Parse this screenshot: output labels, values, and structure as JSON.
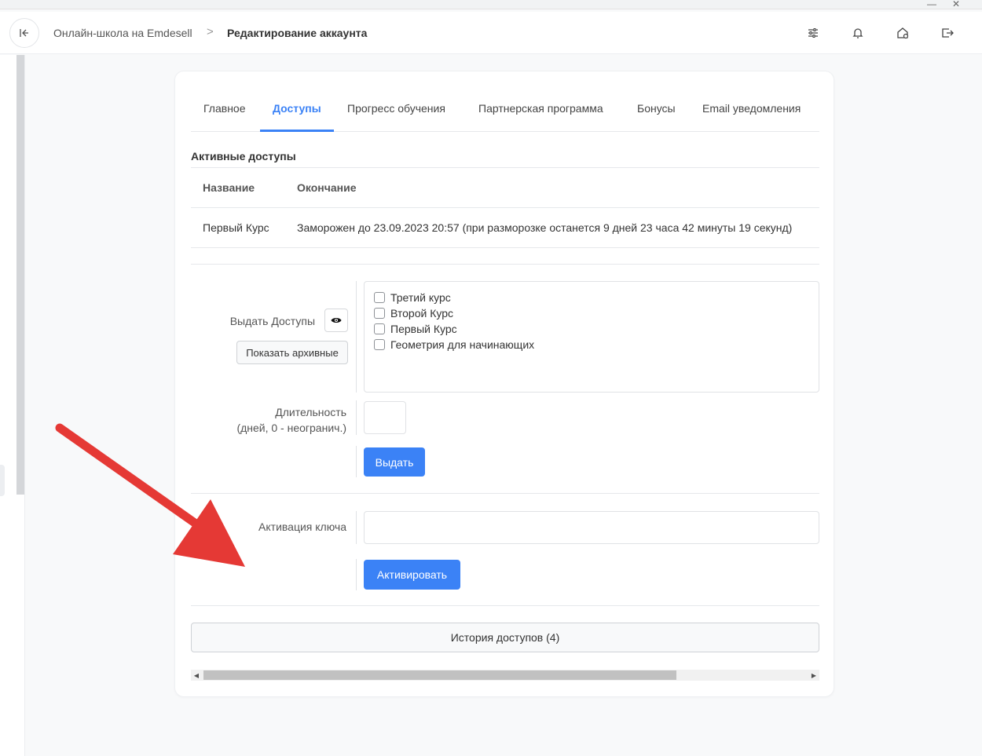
{
  "header": {
    "back_icon": "collapse-left-icon",
    "breadcrumb_root": "Онлайн-школа на Emdesell",
    "breadcrumb_separator": ">",
    "breadcrumb_current": "Редактирование аккаунта",
    "icons": [
      "sliders-icon",
      "bell-icon",
      "home-settings-icon",
      "logout-icon"
    ]
  },
  "tabs": [
    {
      "label": "Главное",
      "active": false
    },
    {
      "label": "Доступы",
      "active": true
    },
    {
      "label": "Прогресс обучения",
      "active": false
    },
    {
      "label": "Партнерская программа",
      "active": false
    },
    {
      "label": "Бонусы",
      "active": false
    },
    {
      "label": "Email уведомления",
      "active": false
    }
  ],
  "active_access": {
    "title": "Активные доступы",
    "columns": [
      "Название",
      "Окончание"
    ],
    "rows": [
      {
        "name": "Первый Курс",
        "end": "Заморожен до 23.09.2023 20:57 (при разморозке останется 9 дней 23 часа 42 минуты 19 секунд)"
      }
    ]
  },
  "grant": {
    "label": "Выдать Доступы",
    "eye_icon": "eye-icon",
    "show_archived_label": "Показать архивные",
    "courses": [
      "Третий курс",
      "Второй Курс",
      "Первый Курс",
      "Геометрия для начинающих"
    ],
    "duration_label_1": "Длительность",
    "duration_label_2": "(дней, 0 - неогранич.)",
    "duration_value": "",
    "submit_label": "Выдать"
  },
  "key": {
    "label": "Активация ключа",
    "value": "",
    "submit_label": "Активировать"
  },
  "history_label": "История доступов (4)",
  "colors": {
    "primary": "#3b82f6",
    "annotation_arrow": "#e53935"
  }
}
